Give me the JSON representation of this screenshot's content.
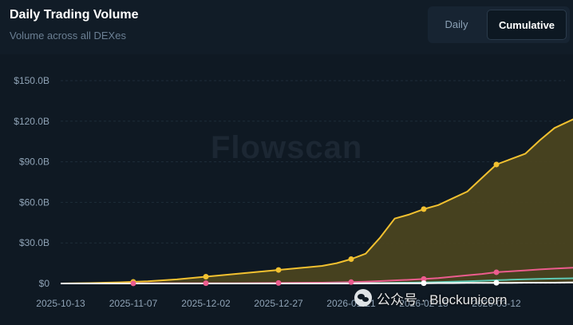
{
  "header": {
    "title": "Daily Trading Volume",
    "subtitle": "Volume across all DEXes"
  },
  "toggle": {
    "daily_label": "Daily",
    "cumulative_label": "Cumulative",
    "active": "Cumulative"
  },
  "watermark": {
    "text": "Flowscan"
  },
  "overlay": {
    "wechat_text": "公众号 · Blockunicorn"
  },
  "colors": {
    "background": "#0f1923",
    "grid": "#1f2d3a",
    "axis_text": "#8fa3b6",
    "series_1": "#f2c130",
    "series_2": "#ec5c8e",
    "series_3": "#5ec9b4",
    "series_4": "#ffffff"
  },
  "chart_data": {
    "type": "area",
    "title": "Daily Trading Volume",
    "xlabel": "",
    "ylabel": "",
    "x_ticks": [
      "2025-10-13",
      "2025-11-07",
      "2025-12-02",
      "2025-12-27",
      "2026-01-21",
      "2026-02-15",
      "2026-03-12"
    ],
    "y_ticks": [
      "$0",
      "$30.0B",
      "$60.0B",
      "$90.0B",
      "$120.0B",
      "$150.0B"
    ],
    "ylim": [
      0,
      150
    ],
    "y_unit": "billion USD",
    "grid": true,
    "legend": "none",
    "x": [
      "2025-10-13",
      "2025-10-23",
      "2025-11-02",
      "2025-11-12",
      "2025-11-22",
      "2025-12-02",
      "2025-12-12",
      "2025-12-22",
      "2026-01-01",
      "2026-01-11",
      "2026-01-16",
      "2026-01-21",
      "2026-01-26",
      "2026-01-31",
      "2026-02-05",
      "2026-02-10",
      "2026-02-15",
      "2026-02-20",
      "2026-02-25",
      "2026-03-02",
      "2026-03-07",
      "2026-03-12",
      "2026-03-17",
      "2026-03-22",
      "2026-03-27",
      "2026-04-01",
      "2026-04-06",
      "2026-04-11",
      "2026-04-16"
    ],
    "series": [
      {
        "values": [
          0,
          0.3,
          0.8,
          1.6,
          3,
          5,
          7,
          9,
          11,
          13,
          15,
          18,
          22,
          34,
          48,
          51,
          55,
          58,
          63,
          68,
          78,
          88,
          92,
          96,
          106,
          115,
          120,
          125,
          129
        ],
        "markers": [
          "2025-11-07",
          "2025-12-02",
          "2025-12-27",
          "2026-01-21",
          "2026-02-15",
          "2026-03-12"
        ]
      },
      {
        "values": [
          0,
          0,
          0,
          0.1,
          0.1,
          0.2,
          0.2,
          0.3,
          0.4,
          0.6,
          0.8,
          1,
          1.3,
          1.8,
          2.3,
          2.7,
          3.3,
          4,
          5,
          6,
          7,
          8.3,
          9,
          9.7,
          10.4,
          11,
          11.5,
          12,
          12.5
        ],
        "markers": [
          "2025-11-07",
          "2025-12-02",
          "2025-12-27",
          "2026-01-21",
          "2026-02-15",
          "2026-03-12"
        ]
      },
      {
        "values": [
          0,
          0,
          0,
          0,
          0,
          0,
          0,
          0,
          0,
          0,
          0.1,
          0.1,
          0.2,
          0.3,
          0.4,
          0.6,
          0.8,
          1,
          1.3,
          1.6,
          2,
          2.4,
          2.8,
          3.1,
          3.4,
          3.6,
          3.8,
          4,
          4.2
        ],
        "markers": []
      },
      {
        "values": [
          0,
          0,
          0,
          0,
          0,
          0,
          0,
          0,
          0,
          0,
          0,
          0,
          0.1,
          0.1,
          0.1,
          0.2,
          0.2,
          0.3,
          0.3,
          0.4,
          0.4,
          0.5,
          0.5,
          0.6,
          0.6,
          0.6,
          0.7,
          0.7,
          0.7
        ],
        "markers": [
          "2026-02-15",
          "2026-03-12"
        ]
      }
    ]
  }
}
